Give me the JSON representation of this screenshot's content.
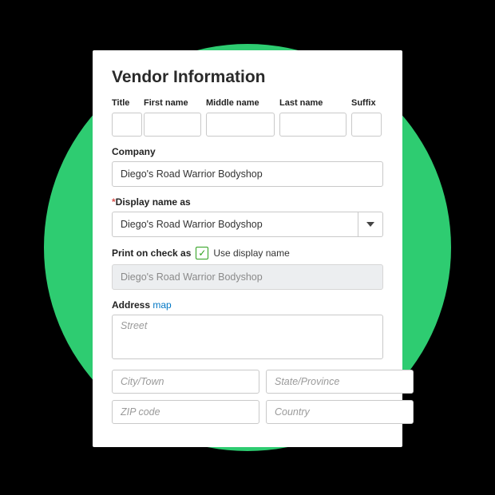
{
  "title": "Vendor Information",
  "name_row": {
    "title_label": "Title",
    "first_label": "First name",
    "middle_label": "Middle name",
    "last_label": "Last name",
    "suffix_label": "Suffix"
  },
  "company": {
    "label": "Company",
    "value": "Diego's Road Warrior Bodyshop"
  },
  "display_name": {
    "required_mark": "*",
    "label": "Display name as",
    "value": "Diego's Road Warrior Bodyshop"
  },
  "print_check": {
    "label": "Print on check as",
    "checkbox_checked": true,
    "checkbox_label": "Use display name",
    "value": "Diego's Road Warrior Bodyshop"
  },
  "address": {
    "label": "Address",
    "map_link": "map",
    "street_placeholder": "Street",
    "city_placeholder": "City/Town",
    "state_placeholder": "State/Province",
    "zip_placeholder": "ZIP code",
    "country_placeholder": "Country"
  }
}
